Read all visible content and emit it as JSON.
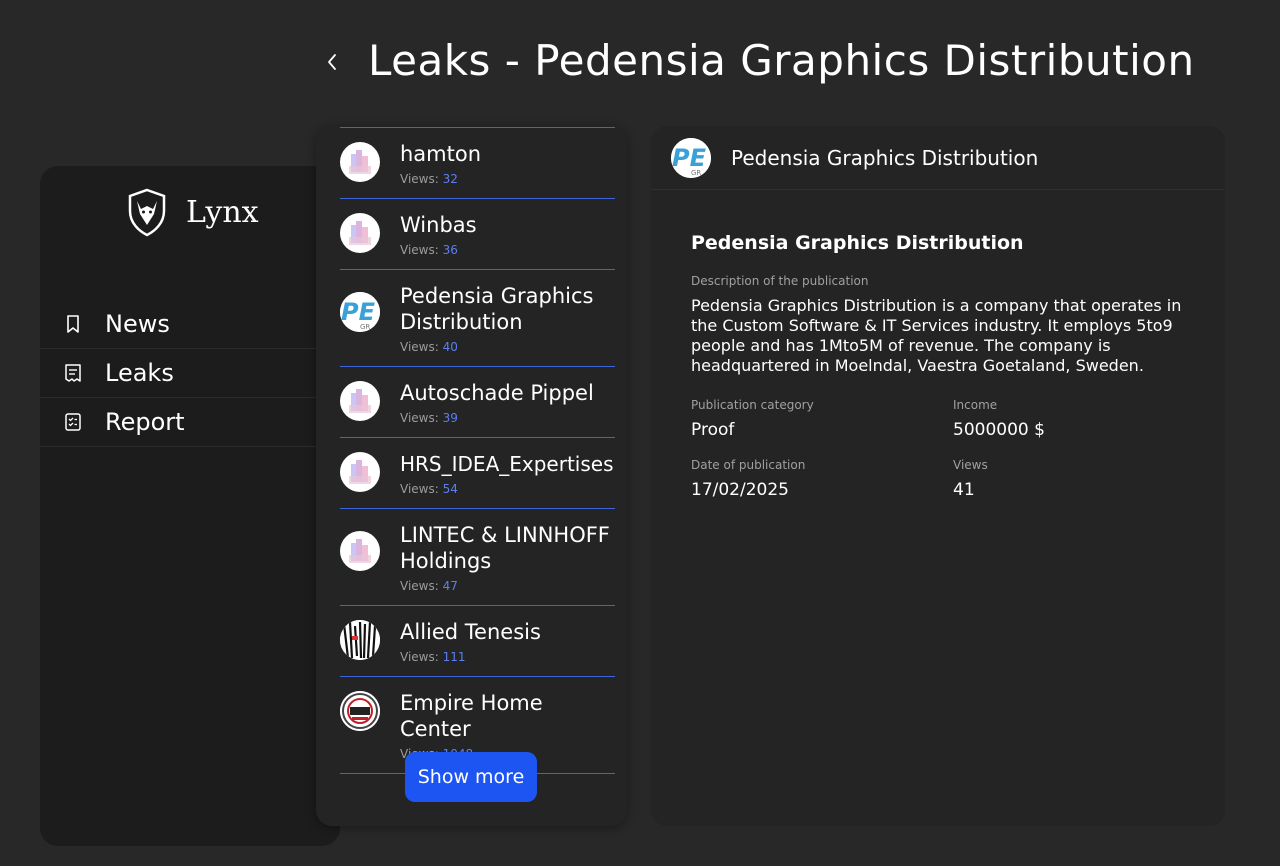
{
  "header": {
    "title": "Leaks - Pedensia Graphics Distribution"
  },
  "sidebar": {
    "brand": "Lynx",
    "nav": [
      {
        "label": "News",
        "icon": "bookmark-icon"
      },
      {
        "label": "Leaks",
        "icon": "receipt-icon"
      },
      {
        "label": "Report",
        "icon": "clipboard-check-icon"
      }
    ]
  },
  "list": {
    "items": [
      {
        "name": "hamton",
        "views_label": "Views:",
        "views": "32",
        "avatar": "placeholder"
      },
      {
        "name": "Winbas",
        "views_label": "Views:",
        "views": "36",
        "avatar": "placeholder"
      },
      {
        "name": "Pedensia Graphics Distribution",
        "views_label": "Views:",
        "views": "40",
        "avatar": "pg-logo"
      },
      {
        "name": "Autoschade Pippel",
        "views_label": "Views:",
        "views": "39",
        "avatar": "placeholder"
      },
      {
        "name": "HRS_IDEA_Expertises",
        "views_label": "Views:",
        "views": "54",
        "avatar": "placeholder"
      },
      {
        "name": "LINTEC & LINNHOFF Holdings",
        "views_label": "Views:",
        "views": "47",
        "avatar": "placeholder"
      },
      {
        "name": "Allied Tenesis",
        "views_label": "Views:",
        "views": "111",
        "avatar": "striped-logo"
      },
      {
        "name": "Empire Home Center",
        "views_label": "Views:",
        "views": "1048",
        "avatar": "seal-logo"
      }
    ],
    "show_more": "Show more"
  },
  "detail": {
    "header_title": "Pedensia Graphics Distribution",
    "title": "Pedensia Graphics Distribution",
    "description_label": "Description of the publication",
    "description": "Pedensia Graphics Distribution is a company that operates in the Custom Software & IT Services industry. It employs 5to9 people and has 1Mto5M of revenue. The company is headquartered in Moelndal, Vaestra Goetaland, Sweden.",
    "category_label": "Publication category",
    "category": "Proof",
    "income_label": "Income",
    "income": "5000000 $",
    "date_label": "Date of publication",
    "date": "17/02/2025",
    "views_label": "Views",
    "views": "41"
  },
  "colors": {
    "accent": "#1d55f2",
    "divider": "#3f64d8",
    "views_number": "#5b7ff0",
    "background": "#282828",
    "panel": "#242424",
    "sidebar": "#1c1c1c"
  }
}
